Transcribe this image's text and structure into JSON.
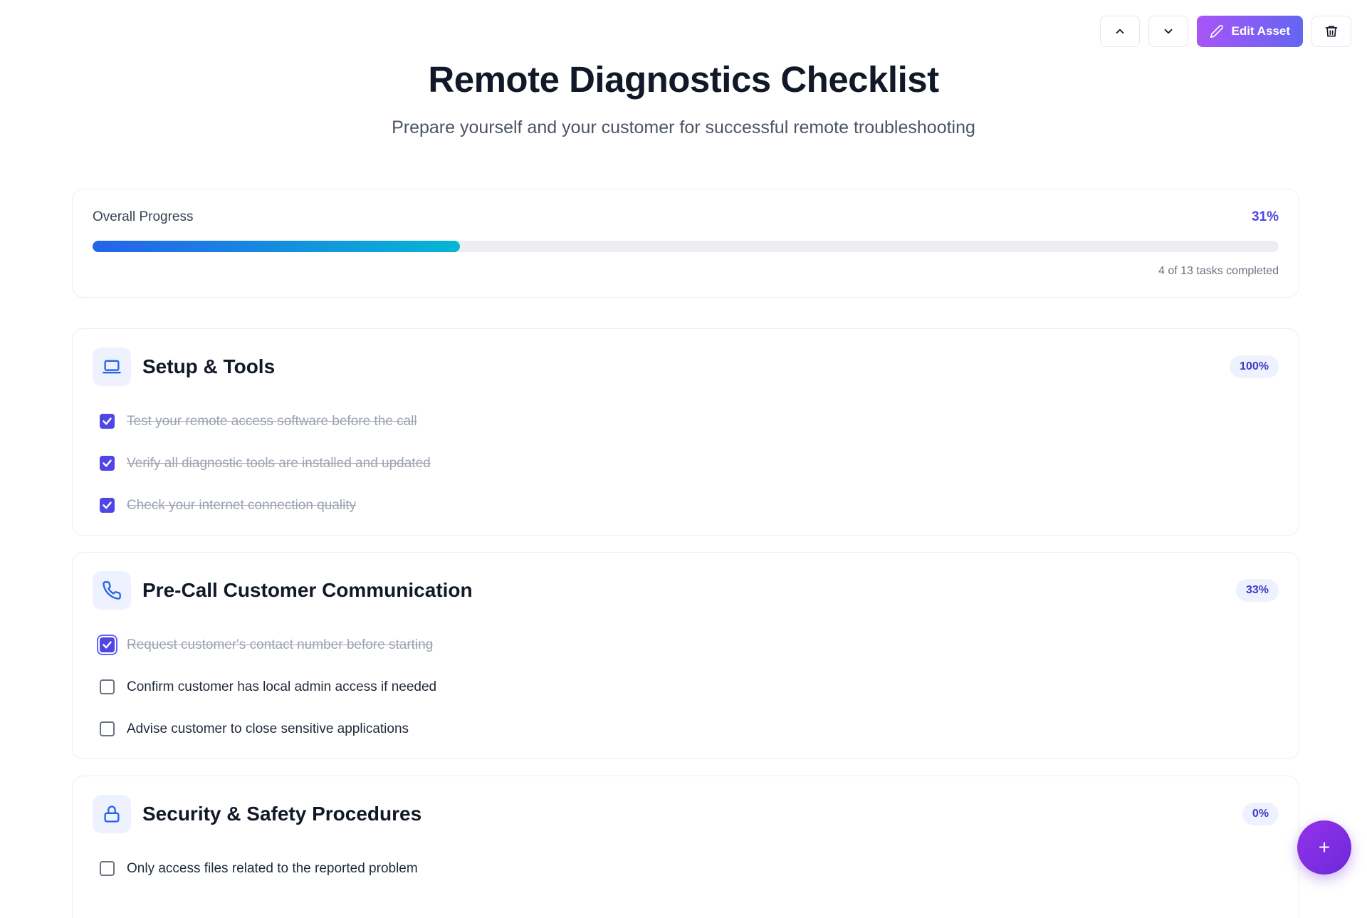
{
  "toolbar": {
    "edit_label": "Edit Asset",
    "icons": [
      "chevron-up-icon",
      "chevron-down-icon",
      "pencil-icon",
      "trash-icon"
    ]
  },
  "header": {
    "title": "Remote Diagnostics Checklist",
    "subtitle": "Prepare yourself and your customer for successful remote troubleshooting"
  },
  "progress": {
    "label": "Overall Progress",
    "percent_label": "31%",
    "fraction": 0.31,
    "count_label": "4 of 13 tasks completed"
  },
  "sections": [
    {
      "title": "Setup & Tools",
      "icon": "laptop-icon",
      "badge": "100%",
      "items": [
        {
          "label": "Test your remote access software before the call",
          "checked": true
        },
        {
          "label": "Verify all diagnostic tools are installed and updated",
          "checked": true
        },
        {
          "label": "Check your internet connection quality",
          "checked": true
        }
      ]
    },
    {
      "title": "Pre-Call Customer Communication",
      "icon": "phone-icon",
      "badge": "33%",
      "items": [
        {
          "label": "Request customer's contact number before starting",
          "checked": true
        },
        {
          "label": "Confirm customer has local admin access if needed",
          "checked": false
        },
        {
          "label": "Advise customer to close sensitive applications",
          "checked": false
        }
      ]
    },
    {
      "title": "Security & Safety Procedures",
      "icon": "lock-icon",
      "badge": "0%",
      "items": [
        {
          "label": "Only access files related to the reported problem",
          "checked": false
        }
      ]
    }
  ],
  "fab": {
    "label": "+"
  },
  "colors": {
    "accent": "#4f46e5",
    "gradient_start": "#2563eb",
    "gradient_end": "#06b6d4"
  }
}
